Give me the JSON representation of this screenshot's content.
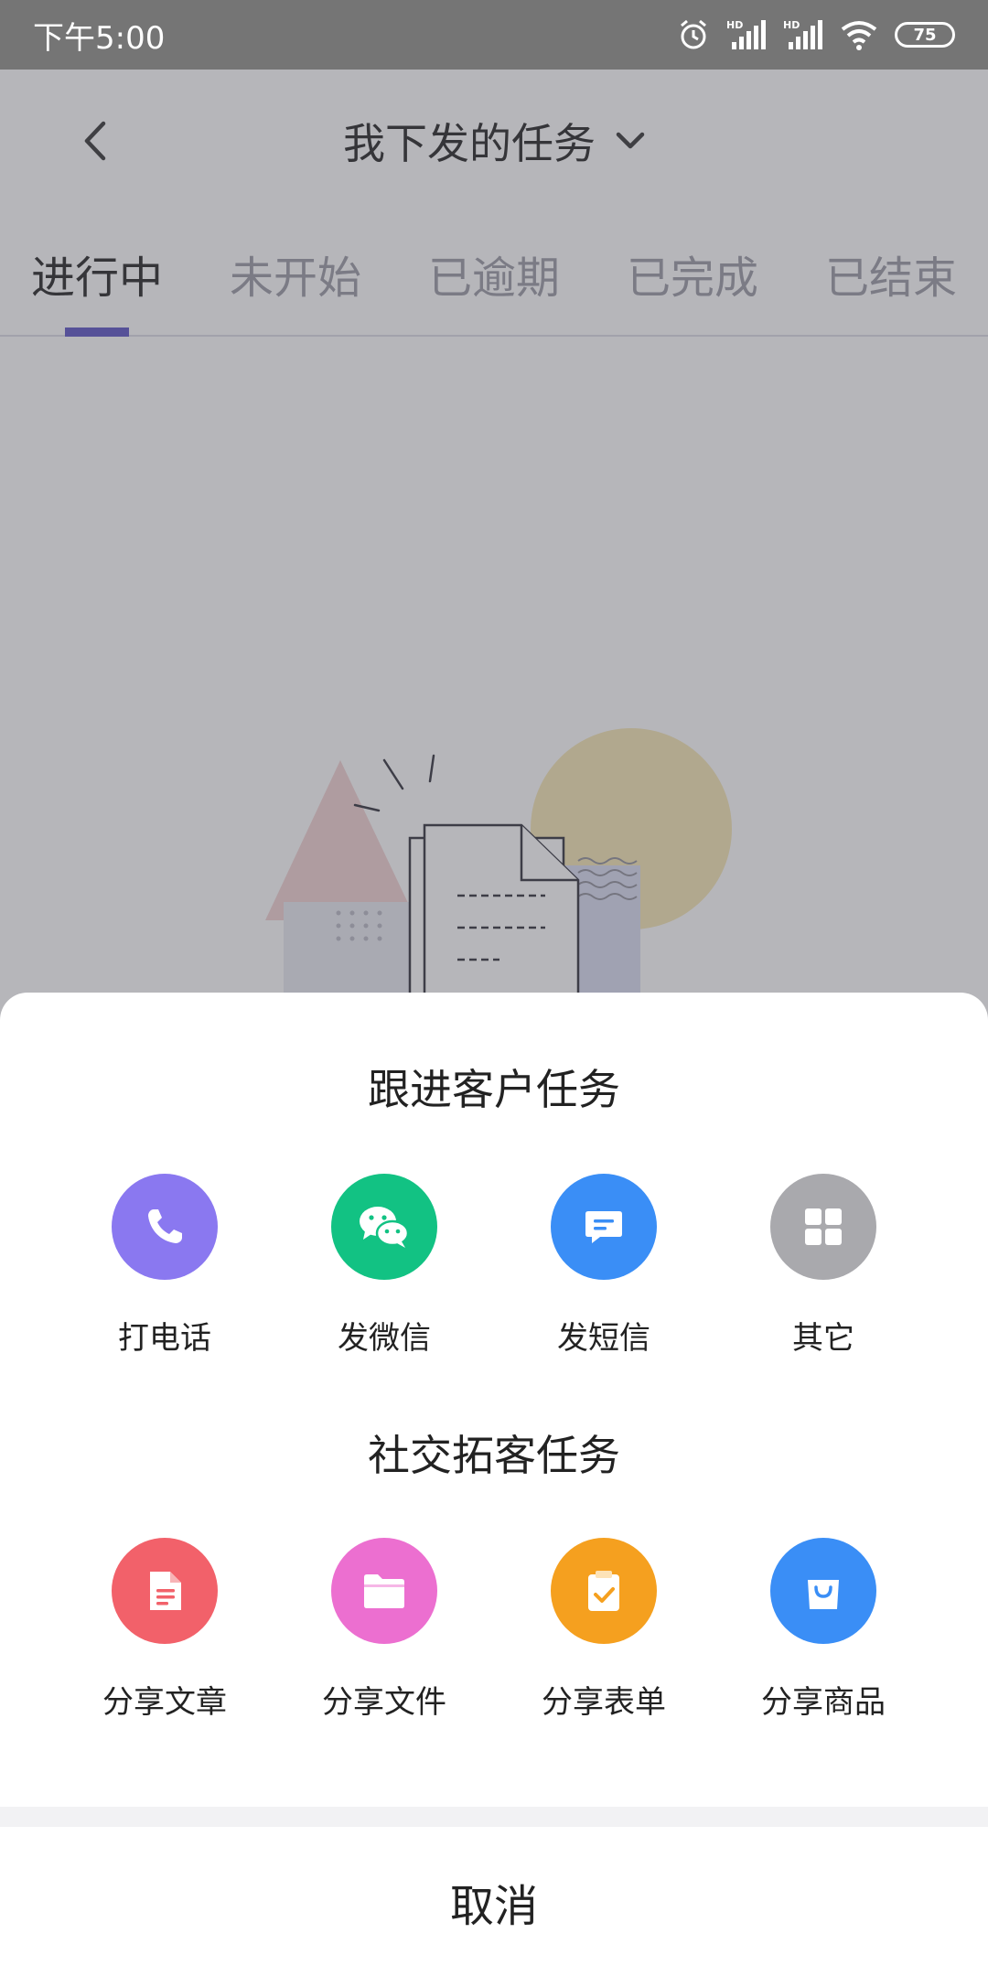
{
  "status_bar": {
    "time": "下午5:00",
    "battery": "75",
    "icons": [
      "alarm-icon",
      "hd-signal-icon",
      "hd-signal-icon",
      "wifi-icon",
      "battery-icon"
    ]
  },
  "header": {
    "title": "我下发的任务",
    "back_icon": "chevron-left-icon",
    "dropdown_icon": "chevron-down-icon"
  },
  "tabs": [
    {
      "label": "进行中",
      "active": true
    },
    {
      "label": "未开始",
      "active": false
    },
    {
      "label": "已逾期",
      "active": false
    },
    {
      "label": "已完成",
      "active": false
    },
    {
      "label": "已结束",
      "active": false
    }
  ],
  "sheet": {
    "follow_up": {
      "title": "跟进客户任务",
      "items": [
        {
          "label": "打电话",
          "icon": "phone-icon",
          "color": "#8a78f0"
        },
        {
          "label": "发微信",
          "icon": "wechat-icon",
          "color": "#12c283"
        },
        {
          "label": "发短信",
          "icon": "message-icon",
          "color": "#3a8ef6"
        },
        {
          "label": "其它",
          "icon": "grid-icon",
          "color": "#a9a9ad"
        }
      ]
    },
    "social": {
      "title": "社交拓客任务",
      "items": [
        {
          "label": "分享文章",
          "icon": "article-icon",
          "color": "#f2616a"
        },
        {
          "label": "分享文件",
          "icon": "folder-icon",
          "color": "#ec6fd0"
        },
        {
          "label": "分享表单",
          "icon": "form-icon",
          "color": "#f5a01f"
        },
        {
          "label": "分享商品",
          "icon": "shopping-bag-icon",
          "color": "#3a8ef6"
        }
      ]
    },
    "cancel_label": "取消"
  },
  "colors": {
    "accent": "#5b52c4",
    "status_bar": "#757575"
  }
}
